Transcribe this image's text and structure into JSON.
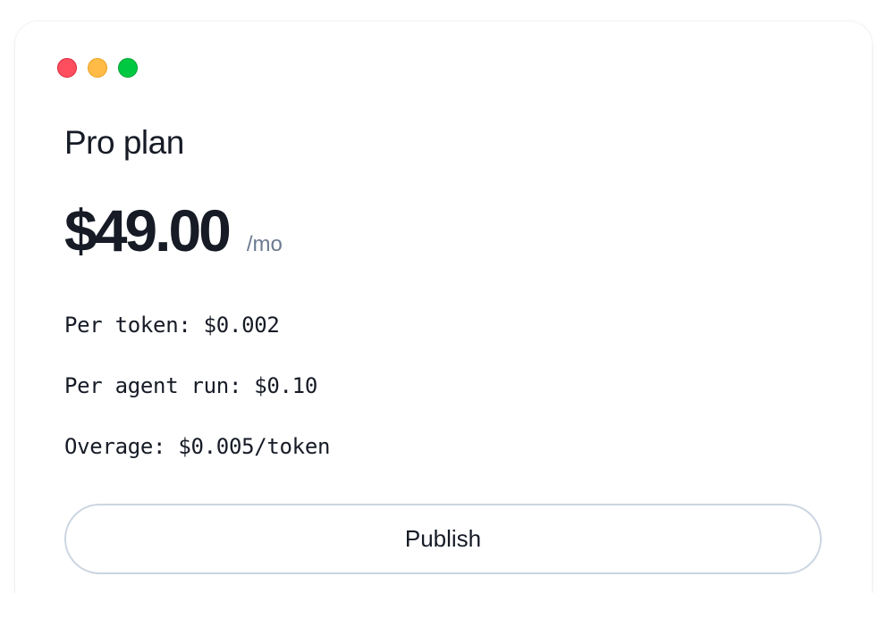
{
  "window": {
    "controls": [
      "close",
      "minimize",
      "zoom"
    ]
  },
  "plan": {
    "name": "Pro plan",
    "price": "$49.00",
    "period": "/mo"
  },
  "details": [
    "Per token: $0.002",
    "Per agent run: $0.10",
    "Overage: $0.005/token"
  ],
  "actions": {
    "publish_label": "Publish"
  },
  "colors": {
    "close": "#ff4f5e",
    "minimize": "#ffbb45",
    "zoom": "#00c840",
    "text": "#161b26",
    "muted": "#6b7a90",
    "button_border": "#cbd5e1"
  }
}
